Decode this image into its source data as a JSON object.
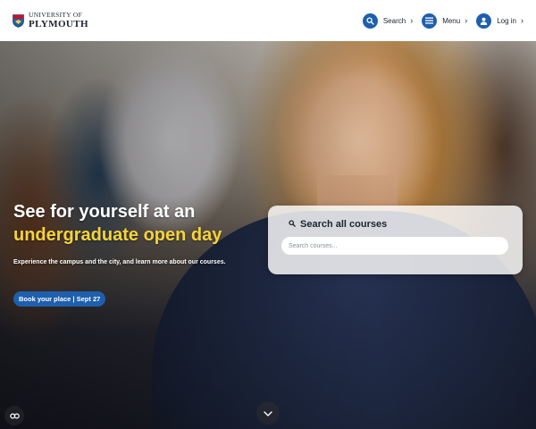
{
  "logo": {
    "line1": "UNIVERSITY OF",
    "line2": "PLYMOUTH",
    "icon": "crest-icon"
  },
  "nav": {
    "items": [
      {
        "label": "Search",
        "icon": "search-icon"
      },
      {
        "label": "Menu",
        "icon": "menu-icon"
      },
      {
        "label": "Log in",
        "icon": "user-icon"
      }
    ]
  },
  "hero": {
    "title_line1": "See for yourself at an",
    "title_line2": "undergraduate open day",
    "subtitle": "Experience the campus and the city, and learn more about our courses.",
    "cta_label": "Book your place | Sept 27"
  },
  "course_search": {
    "heading": "Search all courses",
    "placeholder": "Search courses..."
  },
  "colors": {
    "brand_blue": "#1e5fae",
    "accent_yellow": "#f5d33b"
  }
}
